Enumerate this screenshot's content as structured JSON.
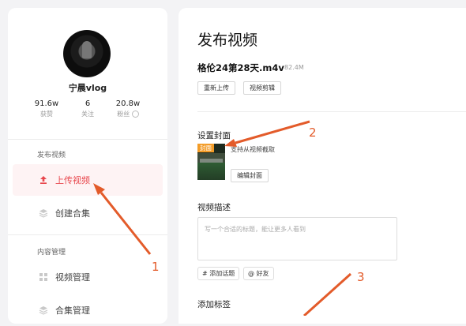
{
  "profile": {
    "username": "宁晨vlog",
    "stats": [
      {
        "value": "91.6w",
        "label": "获赞"
      },
      {
        "value": "6",
        "label": "关注"
      },
      {
        "value": "20.8w",
        "label": "粉丝"
      }
    ]
  },
  "sidebar": {
    "sections": [
      {
        "title": "发布视频",
        "items": [
          {
            "label": "上传视频",
            "icon": "upload-icon"
          },
          {
            "label": "创建合集",
            "icon": "collection-icon"
          }
        ]
      },
      {
        "title": "内容管理",
        "items": [
          {
            "label": "视频管理",
            "icon": "video-grid-icon"
          },
          {
            "label": "合集管理",
            "icon": "collection-manage-icon"
          }
        ]
      }
    ]
  },
  "main": {
    "title": "发布视频",
    "file_name": "格伦24第28天.m4v",
    "file_size": "82.4M",
    "reupload_label": "重新上传",
    "edit_video_label": "视频剪辑",
    "cover_section_label": "设置封面",
    "cover_tag": "封面",
    "cover_hint": "支持从视频截取",
    "edit_cover_label": "编辑封面",
    "description_label": "视频描述",
    "description_placeholder": "写一个合适的标题，能让更多人看到",
    "add_topic_label": "# 添加话题",
    "mention_friend_label": "@ 好友",
    "tags_label": "添加标签"
  },
  "annotations": [
    "1",
    "2",
    "3"
  ],
  "colors": {
    "accent": "#e8474d",
    "annotation": "#e35b2a",
    "cover_tag": "#f39c28"
  }
}
